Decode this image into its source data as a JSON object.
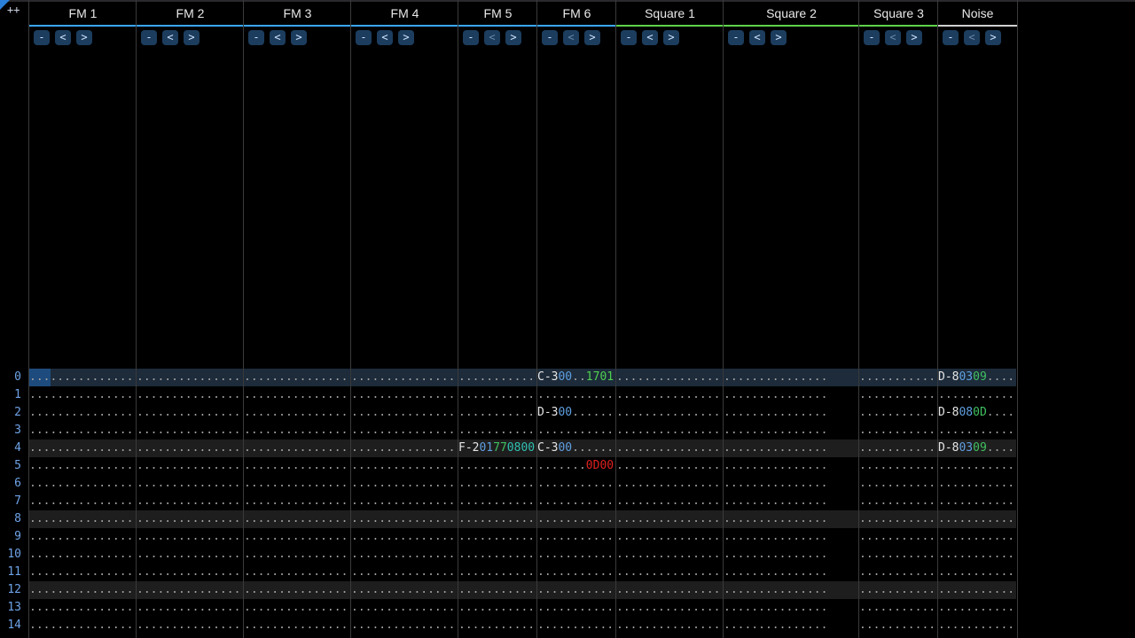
{
  "toolbar": {
    "add_label": "++"
  },
  "channels": [
    {
      "name": "FM 1",
      "bar_color": "#3aa6ff"
    },
    {
      "name": "FM 2",
      "bar_color": "#3aa6ff"
    },
    {
      "name": "FM 3",
      "bar_color": "#3aa6ff"
    },
    {
      "name": "FM 4",
      "bar_color": "#3aa6ff"
    },
    {
      "name": "FM 5",
      "bar_color": "#3aa6ff"
    },
    {
      "name": "FM 6",
      "bar_color": "#3aa6ff"
    },
    {
      "name": "Square 1",
      "bar_color": "#5ed24a"
    },
    {
      "name": "Square 2",
      "bar_color": "#5ed24a"
    },
    {
      "name": "Square 3",
      "bar_color": "#5ed24a"
    },
    {
      "name": "Noise",
      "bar_color": "#d0d0d0"
    }
  ],
  "channel_buttons": {
    "collapse": "-",
    "prev": "<",
    "next": ">"
  },
  "row_numbers": [
    "0",
    "1",
    "2",
    "3",
    "4",
    "5",
    "6",
    "7",
    "8",
    "9",
    "10",
    "11",
    "12",
    "13",
    "14"
  ],
  "cells": {
    "fm5_row4": {
      "note": "F-2",
      "ins": "01",
      "vol": "77",
      "fx": "0800"
    },
    "fm6_row0": {
      "note": "C-3",
      "ins": "00",
      "vol": "..",
      "fx": "1701"
    },
    "fm6_row2": {
      "note": "D-3",
      "ins": "00",
      "vol": "..",
      "fx": "...."
    },
    "fm6_row4": {
      "note": "C-3",
      "ins": "00",
      "vol": "..",
      "fx": "...."
    },
    "fm6_row5": {
      "note": "...",
      "ins": "..",
      "vol": "..",
      "fx": "0D00"
    },
    "noise_row0": {
      "note": "D-8",
      "ins": "03",
      "vol": "09",
      "fx": "...."
    },
    "noise_row2": {
      "note": "D-8",
      "ins": "08",
      "vol": "0D",
      "fx": "...."
    },
    "noise_row4": {
      "note": "D-8",
      "ins": "03",
      "vol": "09",
      "fx": "...."
    }
  },
  "empty_cell": "..............."
}
